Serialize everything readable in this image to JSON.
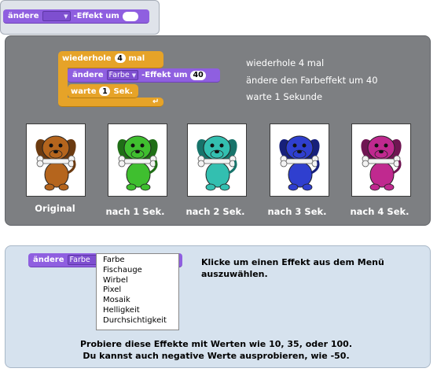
{
  "header_block": {
    "label_before": "ändere",
    "dropdown_value": "",
    "label_after": "-Effekt um",
    "number_value": ""
  },
  "example": {
    "repeat_label": "wiederhole",
    "repeat_count": "4",
    "repeat_suffix": "mal",
    "change_label": "ändere",
    "change_dropdown": "Farbe",
    "change_after": "-Effekt um",
    "change_value": "40",
    "wait_label": "warte",
    "wait_value": "1",
    "wait_suffix": "Sek.",
    "description": [
      "wiederhole 4 mal",
      "ändere den Farbeffekt um 40",
      "warte 1 Sekunde"
    ],
    "frames": [
      {
        "caption": "Original",
        "color": "#b5651d",
        "dark": "#6b3a10"
      },
      {
        "caption": "nach 1 Sek.",
        "color": "#3fbf2f",
        "dark": "#1f6e16"
      },
      {
        "caption": "nach 2 Sek.",
        "color": "#33bfb0",
        "dark": "#17736a"
      },
      {
        "caption": "nach 3 Sek.",
        "color": "#2f3fcf",
        "dark": "#17207a"
      },
      {
        "caption": "nach 4 Sek.",
        "color": "#c0298f",
        "dark": "#6f1552"
      }
    ]
  },
  "menu_demo": {
    "block_label": "ändere",
    "dropdown_value": "Farbe",
    "options": [
      "Farbe",
      "Fischauge",
      "Wirbel",
      "Pixel",
      "Mosaik",
      "Helligkeit",
      "Durchsichtigkeit"
    ],
    "hint": "Klicke um einen Effekt aus dem Menü auszuwählen.",
    "tip_line1": "Probiere diese Effekte mit Werten wie 10, 35, oder 100.",
    "tip_line2": "Du kannst auch negative Werte ausprobieren, wie -50."
  },
  "colors": {
    "looks_block": "#8f5fe0",
    "control_block": "#e6a328",
    "example_panel": "#7d7f82",
    "menu_panel": "#d6e2ee"
  }
}
